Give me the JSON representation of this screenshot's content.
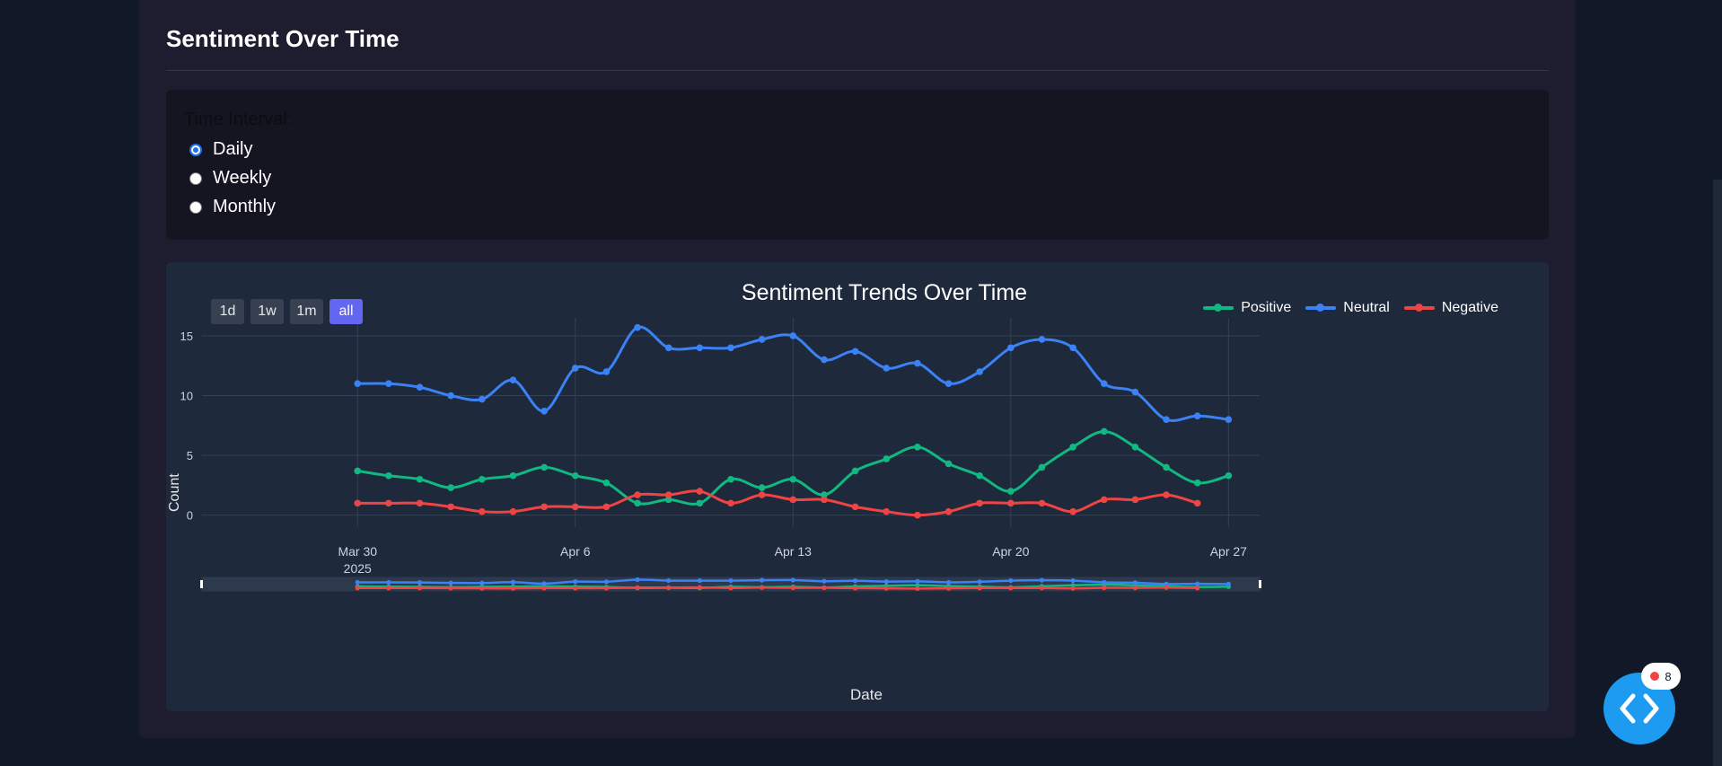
{
  "section": {
    "title": "Sentiment Over Time"
  },
  "interval": {
    "label": "Time Interval:",
    "options": [
      {
        "label": "Daily",
        "checked": true
      },
      {
        "label": "Weekly",
        "checked": false
      },
      {
        "label": "Monthly",
        "checked": false
      }
    ]
  },
  "range_selector": {
    "buttons": [
      {
        "label": "1d",
        "active": false
      },
      {
        "label": "1w",
        "active": false
      },
      {
        "label": "1m",
        "active": false
      },
      {
        "label": "all",
        "active": true
      }
    ]
  },
  "colors": {
    "positive": "#10b981",
    "neutral": "#3b82f6",
    "negative": "#ef4444",
    "range_active": "#6366f1",
    "fab": "#1d9bf0"
  },
  "fab": {
    "badge_count": "8",
    "icon": "code-icon"
  },
  "chart_data": {
    "type": "line",
    "title": "Sentiment Trends Over Time",
    "xlabel": "Date",
    "ylabel": "Count",
    "x_ticks": [
      {
        "label": "Mar 30",
        "sub": "2025",
        "date": "2025-03-30"
      },
      {
        "label": "Apr 6",
        "sub": "",
        "date": "2025-04-06"
      },
      {
        "label": "Apr 13",
        "sub": "",
        "date": "2025-04-13"
      },
      {
        "label": "Apr 20",
        "sub": "",
        "date": "2025-04-20"
      },
      {
        "label": "Apr 27",
        "sub": "",
        "date": "2025-04-27"
      }
    ],
    "y_ticks": [
      "0",
      "5",
      "10",
      "15"
    ],
    "ylim": [
      -1,
      16.5
    ],
    "xlim": [
      "2025-03-25",
      "2025-04-28"
    ],
    "legend_position": "top-right",
    "grid": true,
    "rangeslider": true,
    "x": [
      "2025-03-30",
      "2025-03-31",
      "2025-04-01",
      "2025-04-02",
      "2025-04-03",
      "2025-04-04",
      "2025-04-05",
      "2025-04-06",
      "2025-04-07",
      "2025-04-08",
      "2025-04-09",
      "2025-04-10",
      "2025-04-11",
      "2025-04-12",
      "2025-04-13",
      "2025-04-14",
      "2025-04-15",
      "2025-04-16",
      "2025-04-17",
      "2025-04-18",
      "2025-04-19",
      "2025-04-20",
      "2025-04-21",
      "2025-04-22",
      "2025-04-23",
      "2025-04-24",
      "2025-04-25",
      "2025-04-26",
      "2025-04-27"
    ],
    "series": [
      {
        "name": "Positive",
        "color": "#10b981",
        "values": [
          3.7,
          3.3,
          3.0,
          2.3,
          3.0,
          3.3,
          4.0,
          3.3,
          2.7,
          1.0,
          1.3,
          1.0,
          3.0,
          2.3,
          3.0,
          1.7,
          3.7,
          4.7,
          5.7,
          4.3,
          3.3,
          2.0,
          4.0,
          5.7,
          7.0,
          5.7,
          4.0,
          2.7,
          3.3
        ]
      },
      {
        "name": "Neutral",
        "color": "#3b82f6",
        "values": [
          11.0,
          11.0,
          10.7,
          10.0,
          9.7,
          11.3,
          8.7,
          12.3,
          12.0,
          15.7,
          14.0,
          14.0,
          14.0,
          14.7,
          15.0,
          13.0,
          13.7,
          12.3,
          12.7,
          11.0,
          12.0,
          14.0,
          14.7,
          14.0,
          11.0,
          10.3,
          8.0,
          8.3,
          8.0
        ]
      },
      {
        "name": "Negative",
        "color": "#ef4444",
        "values": [
          1.0,
          1.0,
          1.0,
          0.7,
          0.3,
          0.3,
          0.7,
          0.7,
          0.7,
          1.7,
          1.7,
          2.0,
          1.0,
          1.7,
          1.3,
          1.3,
          0.7,
          0.3,
          0.0,
          0.3,
          1.0,
          1.0,
          1.0,
          0.3,
          1.3,
          1.3,
          1.7,
          1.0,
          null
        ]
      }
    ]
  }
}
